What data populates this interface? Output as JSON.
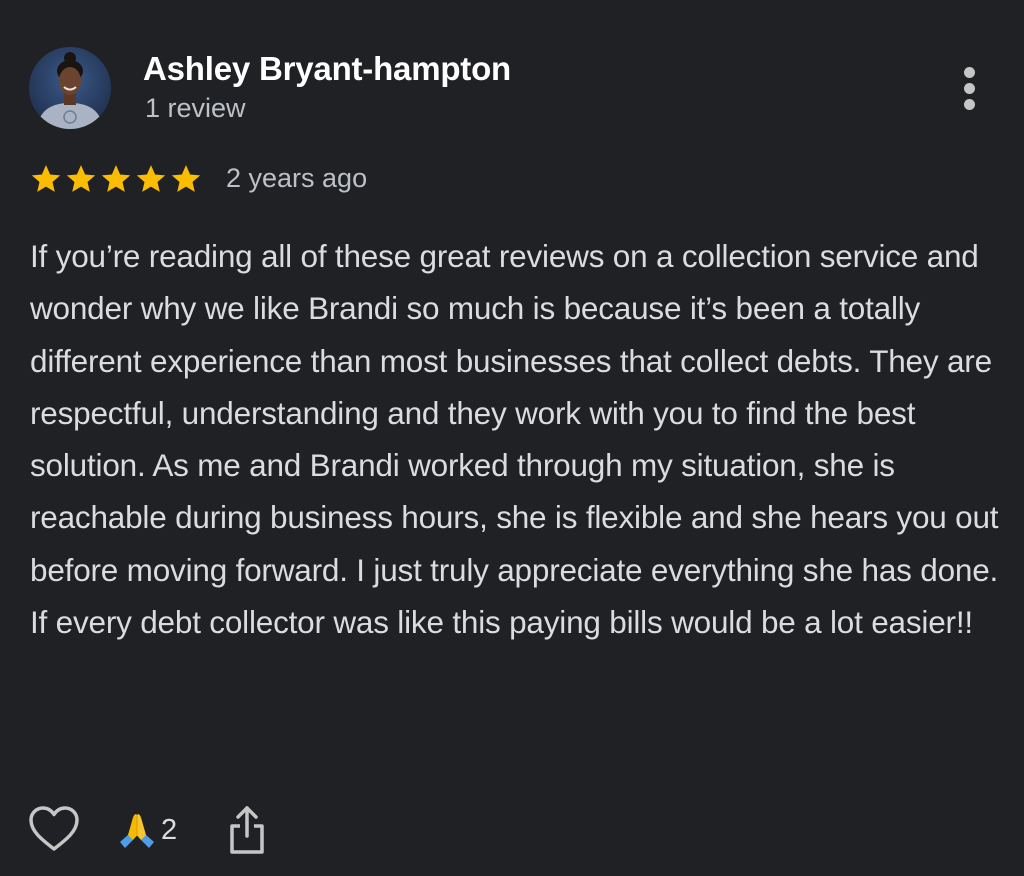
{
  "reviewer": {
    "name": "Ashley Bryant-hampton",
    "review_count": "1 review",
    "avatar_icon": "avatar-photo"
  },
  "rating": {
    "stars": 5,
    "max_stars": 5,
    "star_color": "#fbbc04",
    "time_ago": "2 years ago"
  },
  "review": {
    "text": "If you’re reading all of these great reviews on a collection service and wonder why we like Brandi so much is because it’s been a totally different experience than most businesses that collect debts. They are respectful, understanding and they work with you to find the best solution. As me and Brandi worked through my situation, she is reachable during business hours, she is flexible and she hears you out before moving forward. I just truly appreciate everything she has done. If every debt collector was like this paying bills would be a lot easier!!"
  },
  "actions": {
    "like_icon": "heart-outline-icon",
    "reaction_icon": "folded-hands-emoji",
    "reaction_count": "2",
    "share_icon": "share-icon",
    "more_icon": "more-vertical-icon"
  },
  "colors": {
    "background": "#202124",
    "name": "#ffffff",
    "secondary_text": "#bdc1c6",
    "body_text": "#dadce0"
  }
}
